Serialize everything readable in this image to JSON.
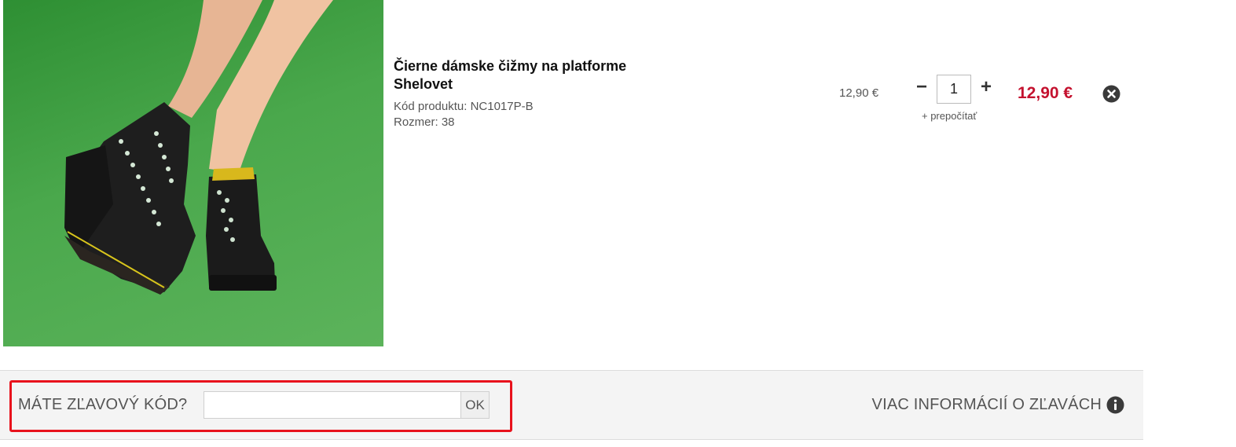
{
  "cart_item": {
    "image_alt_icon": "product-photo",
    "name_line1": "Čierne dámske čižmy na platforme",
    "name_line2": "Shelovet",
    "code_label": "Kód produktu: NC1017P-B",
    "size_label": "Rozmer: 38",
    "unit_price": "12,90 €",
    "quantity": "1",
    "minus_symbol": "−",
    "plus_symbol": "+",
    "recalculate": "+ prepočítať",
    "total_price": "12,90 €",
    "remove_icon": "close-circle-icon"
  },
  "discount": {
    "question": "MÁTE ZĽAVOVÝ KÓD?",
    "input_value": "",
    "ok_button": "OK",
    "more_info": "VIAC INFORMÁCIÍ O ZĽAVÁCH",
    "info_icon": "info-circle-icon",
    "highlight_color": "#e8121c"
  },
  "colors": {
    "price_accent": "#c4122f",
    "bar_background": "#f4f4f4"
  }
}
